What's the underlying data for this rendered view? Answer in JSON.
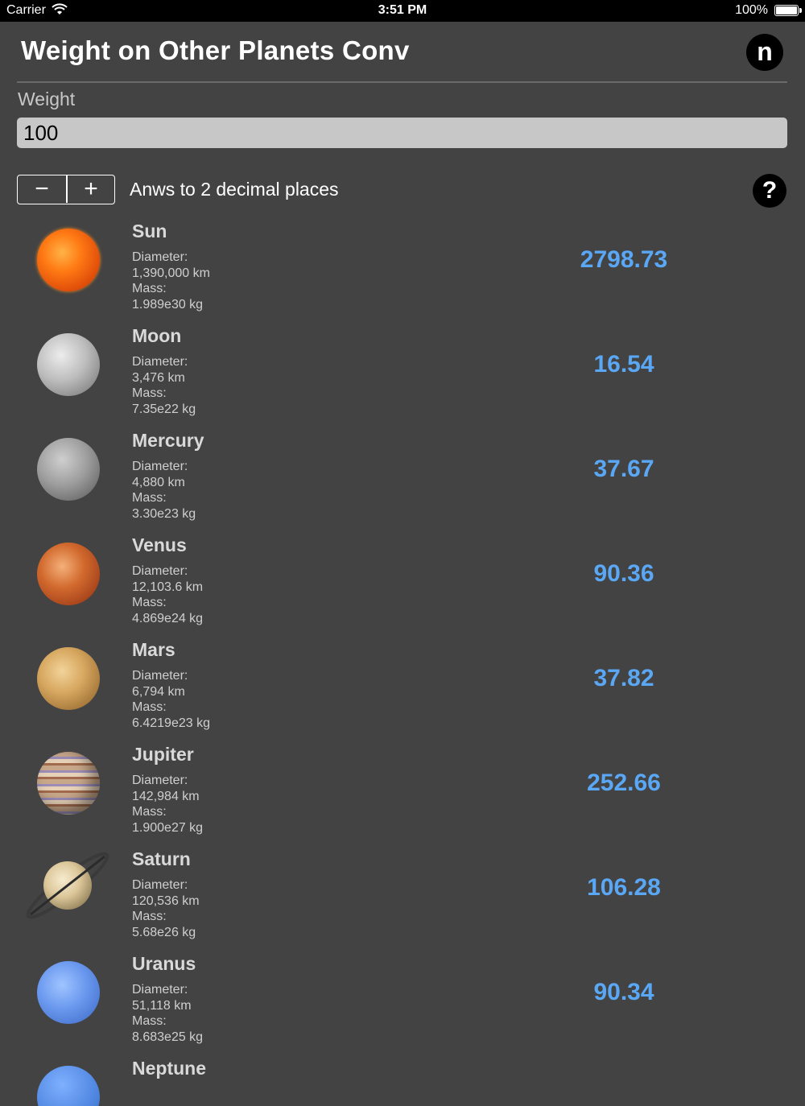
{
  "status_bar": {
    "carrier": "Carrier",
    "time": "3:51 PM",
    "battery": "100%"
  },
  "header": {
    "title": "Weight on Other Planets Conv",
    "n_button": "n"
  },
  "weight": {
    "label": "Weight",
    "value": "100"
  },
  "controls": {
    "minus": "−",
    "plus": "+",
    "decimals_label": "Anws to 2 decimal places",
    "help": "?"
  },
  "planets": [
    {
      "name": "Sun",
      "diameter_label": "Diameter:",
      "diameter": "1,390,000 km",
      "mass_label": "Mass:",
      "mass": "1.989e30 kg",
      "weight": "2798.73",
      "icon": "sun-image"
    },
    {
      "name": "Moon",
      "diameter_label": "Diameter:",
      "diameter": "3,476 km",
      "mass_label": "Mass:",
      "mass": "7.35e22 kg",
      "weight": "16.54",
      "icon": "moon-image"
    },
    {
      "name": "Mercury",
      "diameter_label": "Diameter:",
      "diameter": "4,880 km",
      "mass_label": "Mass:",
      "mass": "3.30e23 kg",
      "weight": "37.67",
      "icon": "mercury-image"
    },
    {
      "name": "Venus",
      "diameter_label": "Diameter:",
      "diameter": "12,103.6 km",
      "mass_label": "Mass:",
      "mass": "4.869e24 kg",
      "weight": "90.36",
      "icon": "venus-image"
    },
    {
      "name": "Mars",
      "diameter_label": "Diameter:",
      "diameter": "6,794 km",
      "mass_label": "Mass:",
      "mass": "6.4219e23 kg",
      "weight": "37.82",
      "icon": "mars-image"
    },
    {
      "name": "Jupiter",
      "diameter_label": "Diameter:",
      "diameter": "142,984 km",
      "mass_label": "Mass:",
      "mass": "1.900e27 kg",
      "weight": "252.66",
      "icon": "jupiter-image"
    },
    {
      "name": "Saturn",
      "diameter_label": "Diameter:",
      "diameter": "120,536 km",
      "mass_label": "Mass:",
      "mass": "5.68e26 kg",
      "weight": "106.28",
      "icon": "saturn-image"
    },
    {
      "name": "Uranus",
      "diameter_label": "Diameter:",
      "diameter": "51,118 km",
      "mass_label": "Mass:",
      "mass": "8.683e25 kg",
      "weight": "90.34",
      "icon": "uranus-image"
    },
    {
      "name": "Neptune",
      "icon": "neptune-image"
    }
  ]
}
